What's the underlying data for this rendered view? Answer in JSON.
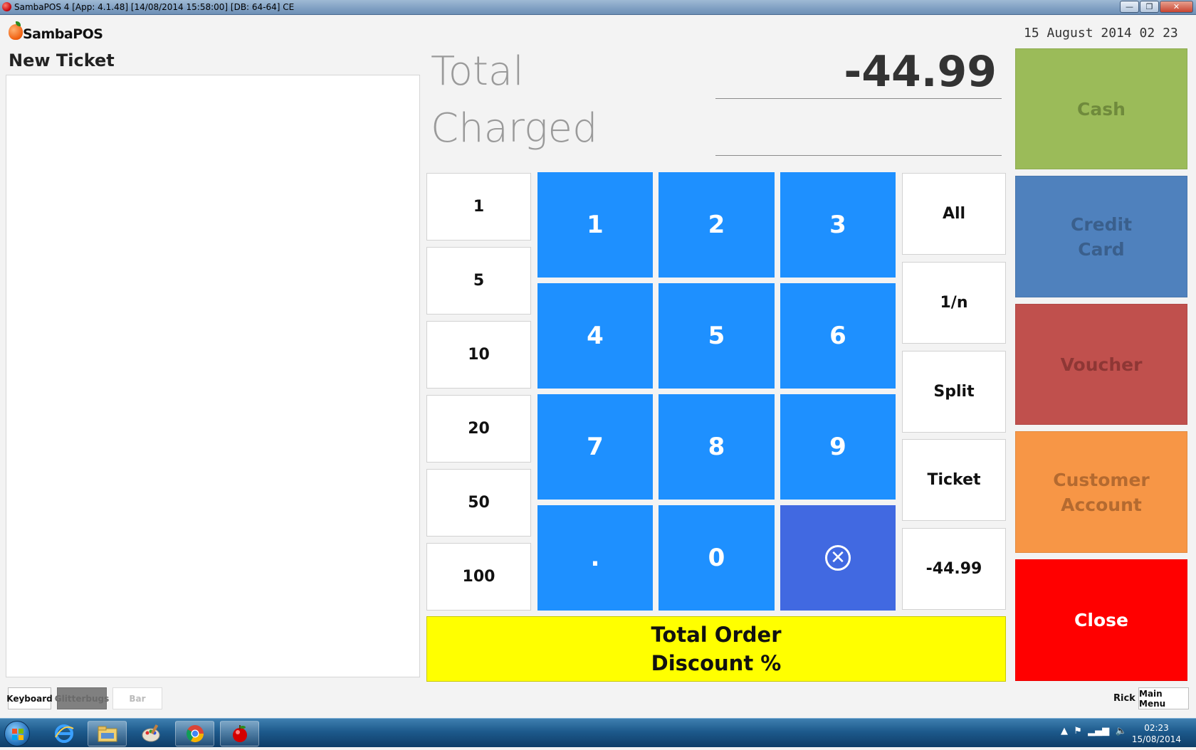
{
  "window": {
    "title": "SambaPOS 4 [App: 4.1.48] [14/08/2014 15:58:00] [DB: 64-64] CE",
    "minimize_label": "—",
    "maximize_label": "❐",
    "close_label": "✕"
  },
  "header": {
    "logo_text": "SambaPOS",
    "datetime": "15 August 2014 02 23"
  },
  "ticket": {
    "title": "New Ticket"
  },
  "totals": {
    "total_label": "Total",
    "total_value": "-44.99",
    "charged_label": "Charged",
    "charged_value": ""
  },
  "quick_amounts": [
    "1",
    "5",
    "10",
    "20",
    "50",
    "100"
  ],
  "numpad": {
    "keys": [
      "1",
      "2",
      "3",
      "4",
      "5",
      "6",
      "7",
      "8",
      "9",
      ".",
      "0"
    ],
    "clear_icon": "clear-circle-x-icon",
    "clear_glyph": "✕"
  },
  "split_options": [
    "All",
    "1/n",
    "Split",
    "Ticket",
    "-44.99"
  ],
  "discount_button": {
    "line1": "Total Order",
    "line2": "Discount %"
  },
  "payment_types": [
    {
      "line1": "Cash",
      "line2": "",
      "color": "#9bbb59",
      "text_color": "#6f8a3c"
    },
    {
      "line1": "Credit",
      "line2": "Card",
      "color": "#4f81bd",
      "text_color": "#3a5f8c"
    },
    {
      "line1": "Voucher",
      "line2": "",
      "color": "#c0504d",
      "text_color": "#8e3735"
    },
    {
      "line1": "Customer",
      "line2": "Account",
      "color": "#f79646",
      "text_color": "#b46a30"
    },
    {
      "line1": "Close",
      "line2": "",
      "color": "#ff0000",
      "text_color": "#ffffff"
    }
  ],
  "footer": {
    "keyboard_label": "Keyboard",
    "department_label": "Glitterbugs",
    "bar_label": "Bar",
    "user_label": "Rick",
    "main_menu_label": "Main Menu"
  },
  "taskbar": {
    "time": "02:23",
    "date": "15/08/2014",
    "items": [
      "internet-explorer-icon",
      "file-explorer-icon",
      "paint-icon",
      "chrome-icon",
      "sambapos-icon"
    ]
  },
  "colors": {
    "numpad_blue": "#1e90ff",
    "clear_blue": "#4169e1",
    "discount_yellow": "#ffff00"
  }
}
